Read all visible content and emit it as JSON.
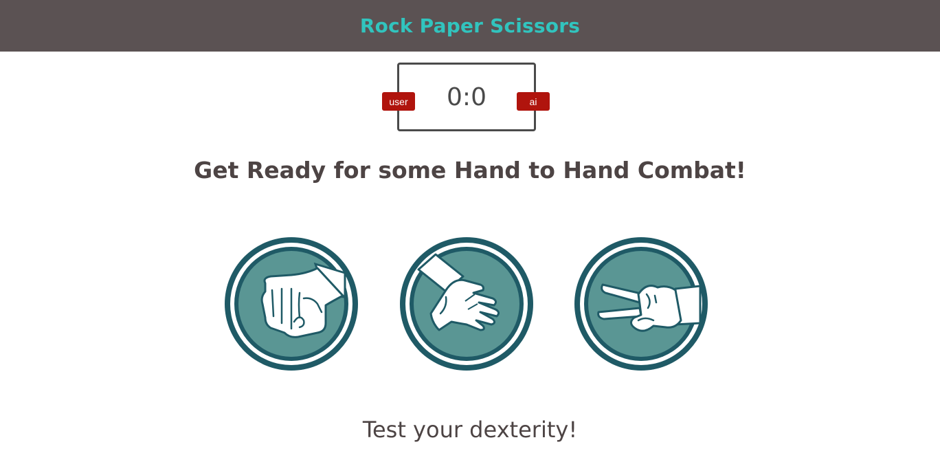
{
  "header": {
    "title": "Rock Paper Scissors"
  },
  "scoreboard": {
    "score": "0:0",
    "user_label": "user",
    "ai_label": "ai"
  },
  "message": "Get Ready for some Hand to Hand Combat!",
  "choices": [
    {
      "name": "rock",
      "icon": "rock-fist-icon"
    },
    {
      "name": "paper",
      "icon": "paper-hand-icon"
    },
    {
      "name": "scissors",
      "icon": "scissors-hand-icon"
    }
  ],
  "footer": {
    "text": "Test your dexterity!"
  },
  "colors": {
    "header_bg": "#5b5253",
    "title": "#31c4be",
    "badge": "#b0140d",
    "circle_outer": "#1f5a66",
    "circle_inner": "#5a9694",
    "text": "#4d4444"
  }
}
